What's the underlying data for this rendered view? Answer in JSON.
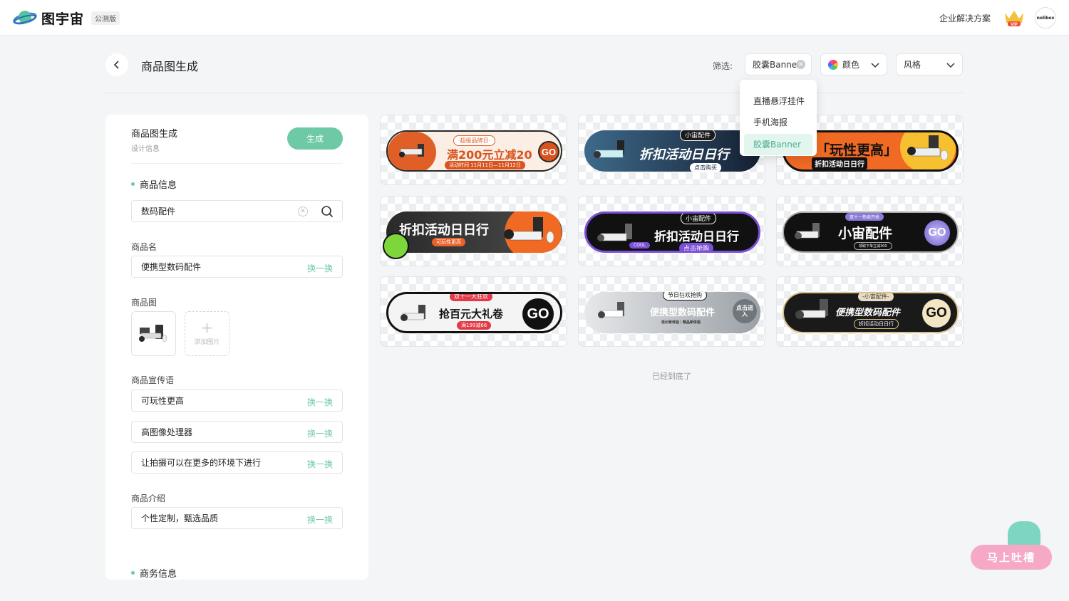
{
  "topbar": {
    "logo_text": "图宇宙",
    "beta": "公测版",
    "enterprise": "企业解决方案",
    "vip": "VIP",
    "avatar": "nolibox"
  },
  "header": {
    "title": "商品图生成",
    "filter_label": "筛选:",
    "type_chip": "胶囊Banner",
    "color_chip": "颜色",
    "style_chip": "风格"
  },
  "dropdown": {
    "items": [
      "直播悬浮挂件",
      "手机海报",
      "胶囊Banner"
    ],
    "selected": "胶囊Banner"
  },
  "panel": {
    "title": "商品图生成",
    "subtitle": "设计信息",
    "generate": "生成",
    "section_product": "商品信息",
    "category_value": "数码配件",
    "name_label": "商品名",
    "name_value": "便携型数码配件",
    "image_label": "商品图",
    "add_image": "添加图片",
    "slogan_label": "商品宣传语",
    "slogans": [
      "可玩性更高",
      "高图像处理器",
      "让拍摄可以在更多的环境下进行"
    ],
    "intro_label": "商品介绍",
    "intro_value": "个性定制，甄选品质",
    "swap": "换一换",
    "section_business": "商务信息"
  },
  "banners": [
    {
      "tag": "·超级品牌日·",
      "main": "满200元立减20",
      "sub": "活动时间 11月11日—11月12日",
      "go": "GO"
    },
    {
      "tag": "小宙配件",
      "main": "折扣活动日日行",
      "sub": "点击购买"
    },
    {
      "main": "「玩性更高」",
      "sub": "折扣活动日日行"
    },
    {
      "main": "折扣活动日日行",
      "sub": "可玩性更高"
    },
    {
      "tag": "小宙配件",
      "main": "折扣活动日日行",
      "sub": "点击抢购",
      "badge": "COOL"
    },
    {
      "tag": "双十一热卖开抢",
      "main": "小宙配件",
      "sub": "领取下单立减300",
      "go": "GO"
    },
    {
      "tag": "双十一大狂欢",
      "main": "抢百元大礼卷",
      "sub": "满199减66",
      "go": "GO"
    },
    {
      "tag": "节日狂欢抢购",
      "main": "便携型数码配件",
      "sub": "低价新体验｜精品新体验",
      "go": "点击进入"
    },
    {
      "tag": "-小宙配件-",
      "main": "便携型数码配件",
      "sub": "折扣活动日日行",
      "go": "GO"
    }
  ],
  "bottom_note": "已经到底了",
  "feedback": "马上吐槽",
  "colors": {
    "accent": "#6dc9a6",
    "orange": "#f06a24",
    "dark": "#1b1b1b",
    "purple": "#6a4bd0"
  }
}
